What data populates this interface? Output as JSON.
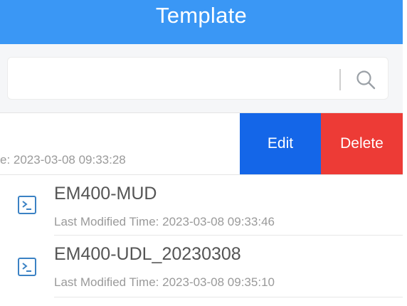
{
  "header": {
    "title": "Template"
  },
  "search": {
    "value": "",
    "placeholder": ""
  },
  "swiped_item": {
    "modified_text": "e: 2023-03-08 09:33:28",
    "edit_label": "Edit",
    "delete_label": "Delete"
  },
  "templates": [
    {
      "name": "EM400-MUD",
      "modified": "Last Modified Time: 2023-03-08 09:33:46"
    },
    {
      "name": "EM400-UDL_20230308",
      "modified": "Last Modified Time: 2023-03-08 09:35:10"
    }
  ],
  "colors": {
    "header": "#3a97f5",
    "edit": "#1466e8",
    "delete": "#ed3b36",
    "icon": "#3b82c4"
  },
  "icons": [
    "search-icon",
    "terminal-file-icon"
  ]
}
